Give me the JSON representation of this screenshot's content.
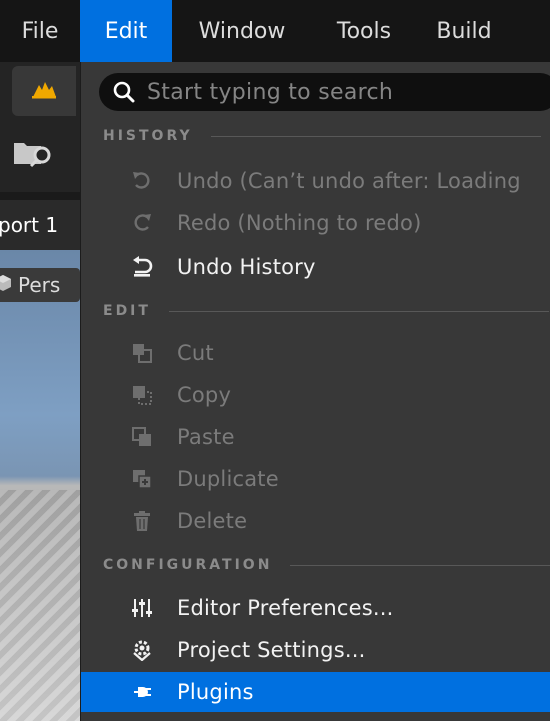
{
  "menubar": {
    "items": [
      {
        "label": "File",
        "active": false
      },
      {
        "label": "Edit",
        "active": true
      },
      {
        "label": "Window",
        "active": false
      },
      {
        "label": "Tools",
        "active": false
      },
      {
        "label": "Build",
        "active": false
      }
    ]
  },
  "background": {
    "viewport_tab_label": "port 1",
    "perspective_label": "Pers"
  },
  "edit_menu": {
    "search": {
      "placeholder": "Start typing to search",
      "value": ""
    },
    "sections": {
      "history": "HISTORY",
      "edit": "EDIT",
      "configuration": "CONFIGURATION"
    },
    "items": {
      "undo": {
        "label": "Undo (Can’t undo after: Loading",
        "icon": "undo-icon",
        "enabled": false
      },
      "redo": {
        "label": "Redo (Nothing to redo)",
        "icon": "redo-icon",
        "enabled": false
      },
      "undo_history": {
        "label": "Undo History",
        "icon": "undo-history-icon",
        "enabled": true
      },
      "cut": {
        "label": "Cut",
        "icon": "cut-icon",
        "enabled": false
      },
      "copy": {
        "label": "Copy",
        "icon": "copy-icon",
        "enabled": false
      },
      "paste": {
        "label": "Paste",
        "icon": "paste-icon",
        "enabled": false
      },
      "duplicate": {
        "label": "Duplicate",
        "icon": "duplicate-icon",
        "enabled": false
      },
      "delete": {
        "label": "Delete",
        "icon": "trash-icon",
        "enabled": false
      },
      "editor_preferences": {
        "label": "Editor Preferences...",
        "icon": "sliders-icon",
        "enabled": true
      },
      "project_settings": {
        "label": "Project Settings...",
        "icon": "gear-icon",
        "enabled": true
      },
      "plugins": {
        "label": "Plugins",
        "icon": "plug-icon",
        "enabled": true,
        "highlighted": true
      }
    }
  },
  "colors": {
    "accent": "#0070e0",
    "menu_bg": "#383838",
    "menubar_bg": "#151515",
    "disabled_text": "#7b7b7b"
  }
}
